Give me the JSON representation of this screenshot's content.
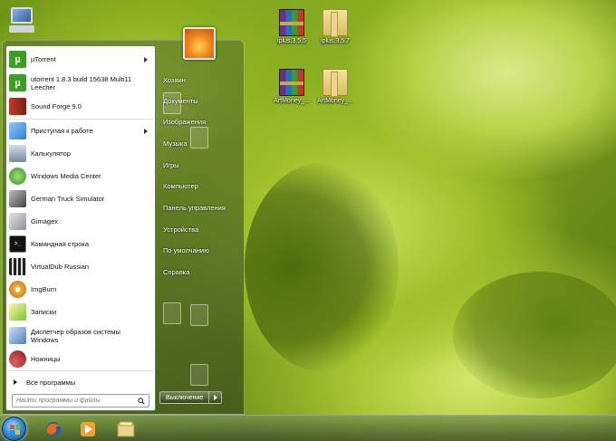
{
  "desktop": {
    "icons": [
      {
        "label": "iplus.3.5.5",
        "kind": "rar"
      },
      {
        "label": "iplus.3.5.7",
        "kind": "folder"
      },
      {
        "label": "ArtMoney_...",
        "kind": "rar"
      },
      {
        "label": "ArtMoney_...",
        "kind": "folder"
      }
    ]
  },
  "start_menu": {
    "programs": [
      {
        "label": "µTorrent",
        "icon": "utorrent-icon",
        "color": "#3f9c2a",
        "glyph": "µ",
        "submenu": true
      },
      {
        "label": "utorrent 1.8.3 build 15638 Multi11 Leecher",
        "icon": "utorrent-icon",
        "color": "#3f9c2a",
        "glyph": "µ",
        "submenu": false
      },
      {
        "label": "Sound Forge 9.0",
        "icon": "sound-forge-icon",
        "color": "#c0392b",
        "glyph": "",
        "submenu": false
      },
      {
        "label": "Приступая к работе",
        "icon": "getting-started-icon",
        "color": "#2f7fd0",
        "glyph": "",
        "submenu": true
      },
      {
        "label": "Калькулятор",
        "icon": "calculator-icon",
        "color": "#7a8aa0",
        "glyph": "",
        "submenu": false
      },
      {
        "label": "Windows Media Center",
        "icon": "media-center-icon",
        "color": "#3aa23a",
        "glyph": "",
        "submenu": false
      },
      {
        "label": "German Truck Simulator",
        "icon": "truck-icon",
        "color": "#555",
        "glyph": "",
        "submenu": false
      },
      {
        "label": "Gimagex",
        "icon": "gimagex-icon",
        "color": "#8a9099",
        "glyph": "",
        "submenu": false
      },
      {
        "label": "Командная строка",
        "icon": "command-prompt-icon",
        "color": "#111",
        "glyph": "",
        "submenu": false
      },
      {
        "label": "VirtualDub Russian",
        "icon": "virtualdub-icon",
        "color": "#333",
        "glyph": "",
        "submenu": false
      },
      {
        "label": "ImgBurn",
        "icon": "imgburn-icon",
        "color": "#d48a1c",
        "glyph": "",
        "submenu": false
      },
      {
        "label": "Записки",
        "icon": "sticky-notes-icon",
        "color": "#7bc043",
        "glyph": "",
        "submenu": false
      },
      {
        "label": "Диспетчер образов системы Windows",
        "icon": "image-manager-icon",
        "color": "#4a7ebb",
        "glyph": "",
        "submenu": false
      },
      {
        "label": "Ножницы",
        "icon": "scissors-icon",
        "color": "#c03a3a",
        "glyph": "",
        "submenu": false
      }
    ],
    "all_programs_label": "Все программы",
    "search_placeholder": "Найти программы и файлы",
    "right_items": [
      "Хозяин",
      "Документы",
      "Изображения",
      "Музыка",
      "Игры",
      "Компьютер",
      "Панель управления",
      "Устройства",
      "По умолчанию",
      "Справка"
    ],
    "shutdown_label": "Выключение"
  },
  "taskbar": {
    "start_icon": "windows-orb-icon",
    "pinned": [
      "firefox-icon",
      "media-player-icon",
      "explorer-icon"
    ]
  }
}
